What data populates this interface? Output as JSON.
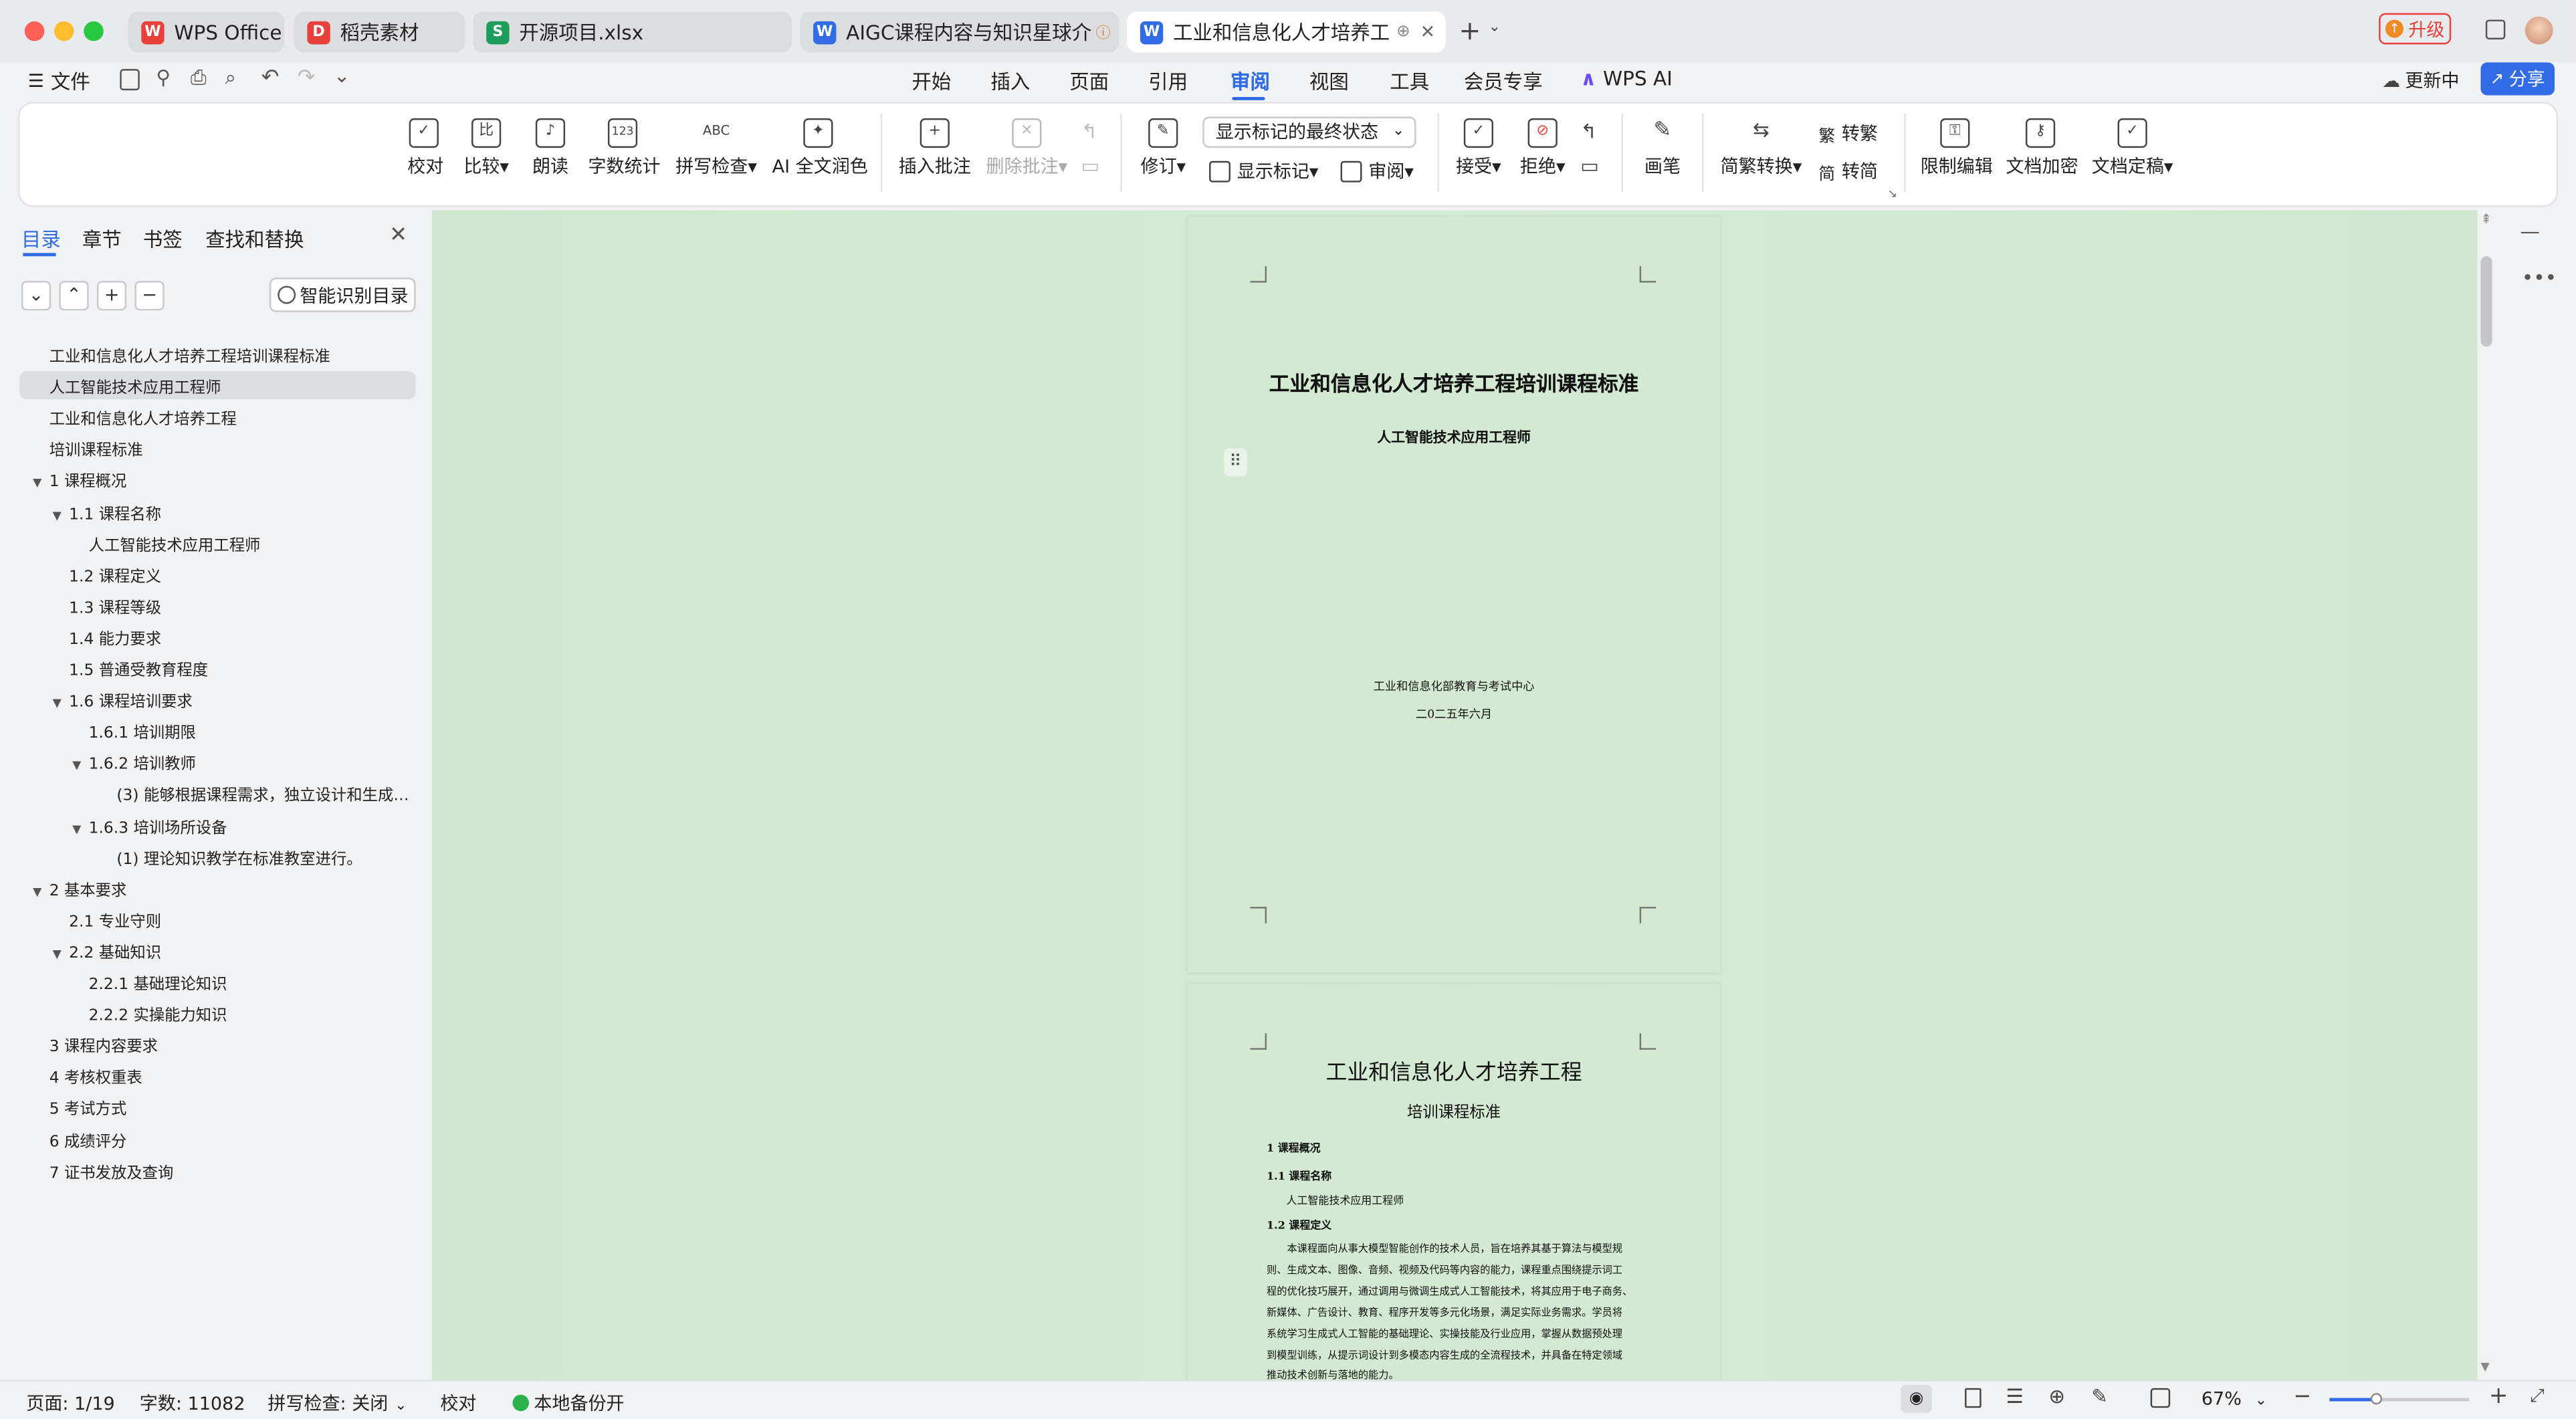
{
  "tabs": [
    {
      "label": "WPS Office",
      "icon": "wps-logo-icon"
    },
    {
      "label": "稻壳素材",
      "icon": "docer-icon"
    },
    {
      "label": "开源项目.xlsx",
      "icon": "spreadsheet-icon"
    },
    {
      "label": "AIGC课程内容与知识星球介绍.d",
      "icon": "word-doc-icon"
    },
    {
      "label": "工业和信息化人才培养工程",
      "icon": "word-doc-icon"
    }
  ],
  "titlebar": {
    "upgrade": "升级"
  },
  "file_menu": "文件",
  "menu_tabs": [
    "开始",
    "插入",
    "页面",
    "引用",
    "审阅",
    "视图",
    "工具",
    "会员专享",
    "WPS AI"
  ],
  "active_menu": "审阅",
  "sync_status": "更新中",
  "share_label": "分享",
  "ribbon": {
    "proofread": "校对",
    "compare": "比较",
    "read_aloud": "朗读",
    "word_count": "字数统计",
    "spell_check": "拼写检查",
    "ai_polish": "AI 全文润色",
    "insert_comment": "插入批注",
    "delete_comment": "删除批注",
    "revise": "修订",
    "markup_state": "显示标记的最终状态",
    "show_markup": "显示标记",
    "review": "审阅",
    "accept": "接受",
    "reject": "拒绝",
    "pen": "画笔",
    "convert": "简繁转换",
    "to_traditional": "转繁",
    "to_simplified": "转简",
    "restrict_edit": "限制编辑",
    "encrypt": "文档加密",
    "finalize": "文档定稿",
    "icon_compare": "比",
    "icon_word_count": "123",
    "icon_spell": "ABC",
    "icon_to_traditional": "繁",
    "icon_to_simplified": "简"
  },
  "sidebar": {
    "tabs": [
      "目录",
      "章节",
      "书签",
      "查找和替换"
    ],
    "smart_toc": "智能识别目录",
    "toc": [
      {
        "text": "工业和信息化人才培养工程培训课程标准",
        "level": 0,
        "caret": ""
      },
      {
        "text": "人工智能技术应用工程师",
        "level": 0,
        "caret": "",
        "selected": true
      },
      {
        "text": "工业和信息化人才培养工程",
        "level": 0,
        "caret": ""
      },
      {
        "text": "培训课程标准",
        "level": 0,
        "caret": ""
      },
      {
        "text": "1  课程概况",
        "level": 0,
        "caret": "▼"
      },
      {
        "text": "1.1  课程名称",
        "level": 1,
        "caret": "▼"
      },
      {
        "text": "人工智能技术应用工程师",
        "level": 2,
        "caret": ""
      },
      {
        "text": "1.2  课程定义",
        "level": 1,
        "caret": ""
      },
      {
        "text": "1.3  课程等级",
        "level": 1,
        "caret": ""
      },
      {
        "text": "1.4  能力要求",
        "level": 1,
        "caret": ""
      },
      {
        "text": "1.5  普通受教育程度",
        "level": 1,
        "caret": ""
      },
      {
        "text": "1.6  课程培训要求",
        "level": 1,
        "caret": "▼"
      },
      {
        "text": "1.6.1  培训期限",
        "level": 2,
        "caret": ""
      },
      {
        "text": "1.6.2  培训教师",
        "level": 2,
        "caret": "▼"
      },
      {
        "text": "(3)  能够根据课程需求，独立设计和生成…",
        "level": 3,
        "caret": ""
      },
      {
        "text": "1.6.3  培训场所设备",
        "level": 2,
        "caret": "▼"
      },
      {
        "text": "(1)  理论知识教学在标准教室进行。",
        "level": 3,
        "caret": ""
      },
      {
        "text": "2  基本要求",
        "level": 0,
        "caret": "▼"
      },
      {
        "text": "2.1  专业守则",
        "level": 1,
        "caret": ""
      },
      {
        "text": "2.2  基础知识",
        "level": 1,
        "caret": "▼"
      },
      {
        "text": "2.2.1  基础理论知识",
        "level": 2,
        "caret": ""
      },
      {
        "text": "2.2.2  实操能力知识",
        "level": 2,
        "caret": ""
      },
      {
        "text": "3  课程内容要求",
        "level": 0,
        "caret": ""
      },
      {
        "text": "4  考核权重表",
        "level": 0,
        "caret": ""
      },
      {
        "text": "5  考试方式",
        "level": 0,
        "caret": ""
      },
      {
        "text": "6  成绩评分",
        "level": 0,
        "caret": ""
      },
      {
        "text": "7  证书发放及查询",
        "level": 0,
        "caret": ""
      }
    ]
  },
  "page1": {
    "title": "工业和信息化人才培养工程培训课程标准",
    "subtitle": "人工智能技术应用工程师",
    "org": "工业和信息化部教育与考试中心",
    "date": "二0二五年六月"
  },
  "page2": {
    "title": "工业和信息化人才培养工程",
    "subtitle": "培训课程标准",
    "h1": "1  课程概况",
    "h11": "1.1  课程名称",
    "name": "人工智能技术应用工程师",
    "h12": "1.2  课程定义",
    "body": [
      "　　本课程面向从事大模型智能创作的技术人员，旨在培养其基于算法与模型规",
      "则、生成文本、图像、音频、视频及代码等内容的能力，课程重点围绕提示词工",
      "程的优化技巧展开，通过调用与微调生成式人工智能技术，将其应用于电子商务、",
      "新媒体、广告设计、教育、程序开发等多元化场景，满足实际业务需求。学员将",
      "系统学习生成式人工智能的基础理论、实操技能及行业应用，掌握从数据预处理",
      "到模型训练，从提示词设计到多模态内容生成的全流程技术，并具备在特定领域",
      "推动技术创新与落地的能力。"
    ]
  },
  "status": {
    "page": "页面: 1/19",
    "words": "字数: 11082",
    "spell": "拼写检查: 关闭",
    "proof": "校对",
    "backup": "本地备份开",
    "zoom": "67%"
  }
}
